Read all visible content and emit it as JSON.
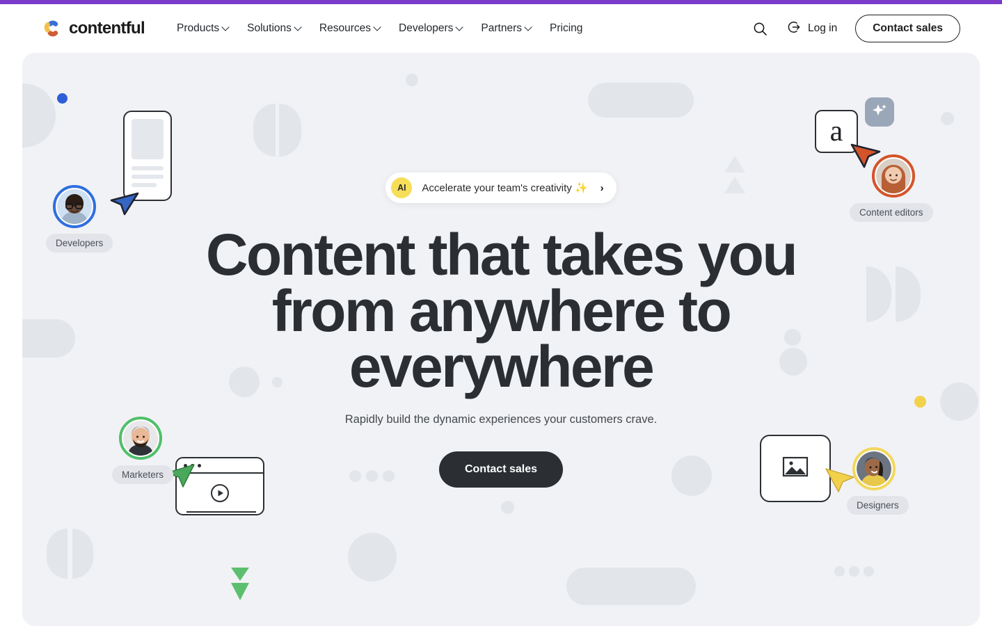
{
  "brand": {
    "name": "contentful",
    "logo_icon": "contentful-logo-icon",
    "accent_purple": "#7c3aca",
    "logo_blue": "#3a6fd8",
    "logo_yellow": "#f2c14b",
    "logo_orange": "#d4613a"
  },
  "header": {
    "nav": [
      {
        "label": "Products",
        "has_dropdown": true
      },
      {
        "label": "Solutions",
        "has_dropdown": true
      },
      {
        "label": "Resources",
        "has_dropdown": true
      },
      {
        "label": "Developers",
        "has_dropdown": true
      },
      {
        "label": "Partners",
        "has_dropdown": true
      },
      {
        "label": "Pricing",
        "has_dropdown": false
      }
    ],
    "search_icon": "search-icon",
    "login_icon": "login-arrow-icon",
    "login_label": "Log in",
    "contact_sales_label": "Contact sales"
  },
  "hero": {
    "ai_badge_text": "AI",
    "ai_message": "Accelerate your team's creativity ✨",
    "ai_arrow": "›",
    "headline": "Content that takes you from anywhere to everywhere",
    "subtitle": "Rapidly build the dynamic experiences your customers crave.",
    "cta_label": "Contact sales",
    "background_color": "#f1f2f5",
    "shape_color": "#e2e5ea"
  },
  "personas": [
    {
      "id": "developers",
      "label": "Developers",
      "ring_color": "#2f6fe0",
      "cursor_color": "#2f5fc0"
    },
    {
      "id": "content-editors",
      "label": "Content editors",
      "ring_color": "#d4542a",
      "cursor_color": "#d4542a"
    },
    {
      "id": "marketers",
      "label": "Marketers",
      "ring_color": "#4fbf6a",
      "cursor_color": "#4fb060"
    },
    {
      "id": "designers",
      "label": "Designers",
      "ring_color": "#f2d75a",
      "cursor_color": "#f2d14b"
    }
  ],
  "illustration": {
    "letter_card_glyph": "a",
    "sparkle_icon": "sparkle-icon",
    "play_icon": "play-icon",
    "image_placeholder_icon": "image-icon",
    "green_arrows_icon": "double-down-arrow-icon",
    "blue_dot_color": "#2f5fd8",
    "yellow_dot_color": "#f2d14b",
    "green_arrow_color": "#5cbf70"
  }
}
